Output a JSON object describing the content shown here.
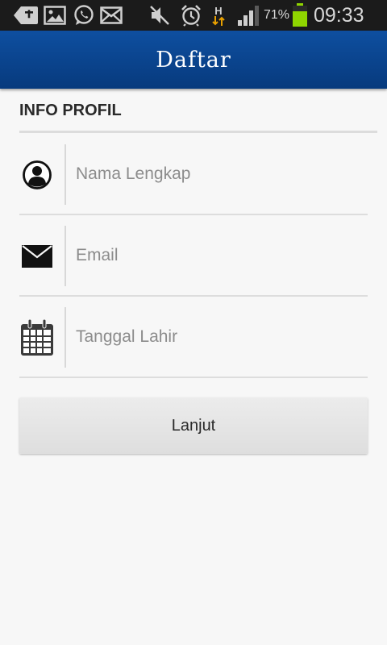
{
  "status_bar": {
    "battery_percent": "71%",
    "time": "09:33",
    "network_label": "H",
    "battery_color": "#8fd500",
    "icons": [
      "add-icon",
      "image-icon",
      "whatsapp-icon",
      "mail-icon",
      "mute-icon",
      "alarm-icon",
      "network-h-icon",
      "signal-icon",
      "battery-icon"
    ]
  },
  "action_bar": {
    "title": "Daftar",
    "color": "#0a4a96"
  },
  "section": {
    "header": "INFO PROFIL"
  },
  "form": {
    "full_name": {
      "placeholder": "Nama Lengkap",
      "value": "",
      "icon": "person-icon"
    },
    "email": {
      "placeholder": "Email",
      "value": "",
      "icon": "envelope-icon"
    },
    "birth_date": {
      "placeholder": "Tanggal Lahir",
      "value": "",
      "icon": "calendar-icon"
    }
  },
  "next_button": {
    "label": "Lanjut"
  }
}
